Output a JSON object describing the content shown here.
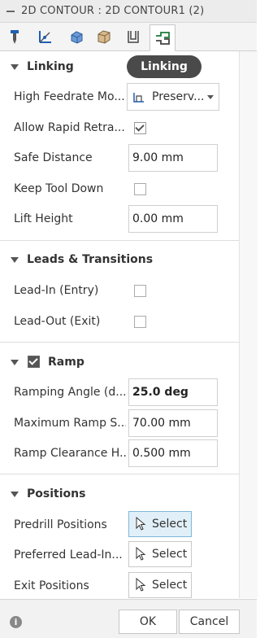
{
  "window": {
    "title": "2D CONTOUR : 2D CONTOUR1 (2)"
  },
  "tabs": [
    {
      "icon": "tool-icon"
    },
    {
      "icon": "geometry-axes-icon"
    },
    {
      "icon": "heights-icon"
    },
    {
      "icon": "stock-box-icon"
    },
    {
      "icon": "passes-icon"
    },
    {
      "icon": "linking-icon",
      "active": true
    }
  ],
  "tooltip": {
    "text": "Linking"
  },
  "sections": {
    "linking": {
      "title": "Linking",
      "high_feedrate": {
        "label": "High Feedrate Mo...",
        "value": "Preserv..."
      },
      "allow_rapid": {
        "label": "Allow Rapid Retra...",
        "checked": true
      },
      "safe_distance": {
        "label": "Safe Distance",
        "value": "9.00 mm"
      },
      "keep_tool_down": {
        "label": "Keep Tool Down",
        "checked": false
      },
      "lift_height": {
        "label": "Lift Height",
        "value": "0.00 mm"
      }
    },
    "leads": {
      "title": "Leads & Transitions",
      "lead_in": {
        "label": "Lead-In (Entry)",
        "checked": false
      },
      "lead_out": {
        "label": "Lead-Out (Exit)",
        "checked": false
      }
    },
    "ramp": {
      "title": "Ramp",
      "enabled": true,
      "ramping_angle": {
        "label": "Ramping Angle (d...",
        "value": "25.0 deg"
      },
      "max_ramp_step": {
        "label": "Maximum Ramp S...",
        "value": "70.00 mm"
      },
      "ramp_clearance": {
        "label": "Ramp Clearance H...",
        "value": "0.500 mm"
      }
    },
    "positions": {
      "title": "Positions",
      "predrill": {
        "label": "Predrill Positions",
        "button": "Select"
      },
      "preferred_lead_in": {
        "label": "Preferred Lead-In...",
        "button": "Select"
      },
      "exit": {
        "label": "Exit Positions",
        "button": "Select"
      }
    }
  },
  "footer": {
    "ok": "OK",
    "cancel": "Cancel"
  },
  "colors": {
    "tooltip_bg": "#4a4a4a",
    "select_active_bg": "#e1f0f8",
    "select_active_border": "#7fb7d9"
  }
}
